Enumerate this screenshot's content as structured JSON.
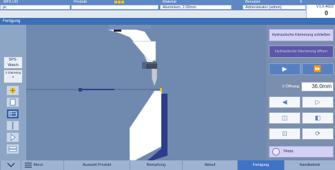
{
  "header": {
    "machine_label": "MFS UD",
    "machine_value": "pc",
    "product_label": "Produkt",
    "material_label": "Material",
    "material_value": "Aluminium, 2.00mm",
    "user_label": "Benutzer",
    "user_value": "Administrator (admin)",
    "user_count": "9",
    "version": "V1.0.4622",
    "counter": "0"
  },
  "title": "Fertigung",
  "left_panel": {
    "sps_label": "SPS-Watch",
    "bias_label": "2 Diamsieg e"
  },
  "right_panel": {
    "clamp_close_label": "Hydraulische Klemmung schließen",
    "clamp_open_label": "Hydraulische Klemmung öffnen",
    "z_opening_label": "Z-Öffnung",
    "z_opening_value": "36.0mm",
    "stop_label": "Stopp"
  },
  "tabs": [
    {
      "label": "Menü"
    },
    {
      "label": "Auswahl Produkt"
    },
    {
      "label": "Bemaßung"
    },
    {
      "label": "Ablauf"
    },
    {
      "label": "Fertigung"
    },
    {
      "label": "Handbetrieb"
    }
  ],
  "colors": {
    "accent": "#3f73c3",
    "button_lilac": "#d3d0f3",
    "button_blue": "#5880c0",
    "stop": "#f3c21b"
  }
}
